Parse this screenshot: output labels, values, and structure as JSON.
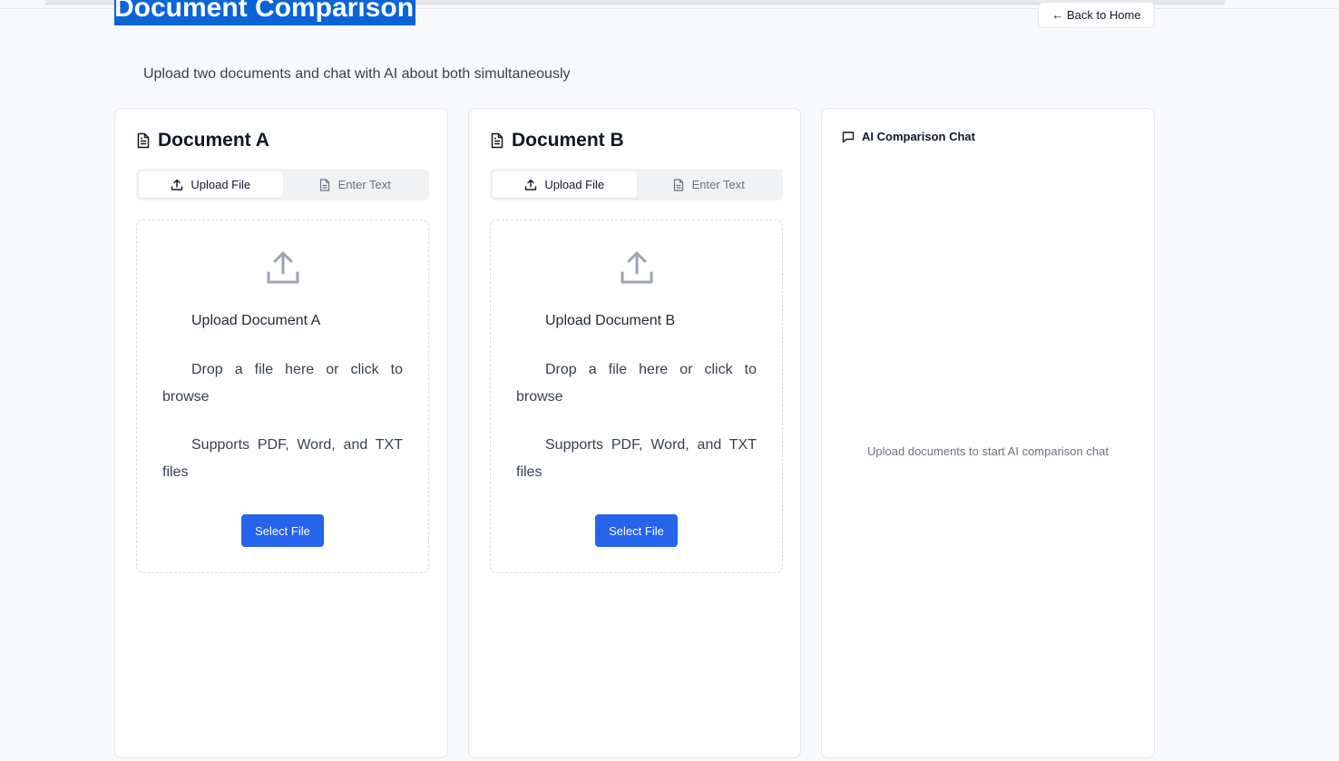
{
  "page": {
    "title": "Document Comparison",
    "back_label": "← Back to Home",
    "subtitle": "Upload two documents and chat with AI about both simultaneously"
  },
  "documents": [
    {
      "title": "Document A",
      "tabs": {
        "upload": "Upload File",
        "text": "Enter Text",
        "active": "upload"
      },
      "dropzone": {
        "title": "Upload Document A",
        "hint": "Drop a file here or click to browse",
        "supports": "Supports PDF, Word, and TXT files",
        "button": "Select File"
      }
    },
    {
      "title": "Document B",
      "tabs": {
        "upload": "Upload File",
        "text": "Enter Text",
        "active": "upload"
      },
      "dropzone": {
        "title": "Upload Document B",
        "hint": "Drop a file here or click to browse",
        "supports": "Supports PDF, Word, and TXT files",
        "button": "Select File"
      }
    }
  ],
  "chat": {
    "title": "AI Comparison Chat",
    "empty_message": "Upload documents to start AI comparison chat"
  },
  "colors": {
    "accent": "#2563eb",
    "selection": "#0a64d8",
    "background": "#f8f9fa"
  },
  "icons": [
    "file-text-icon",
    "upload-icon",
    "message-square-icon"
  ]
}
